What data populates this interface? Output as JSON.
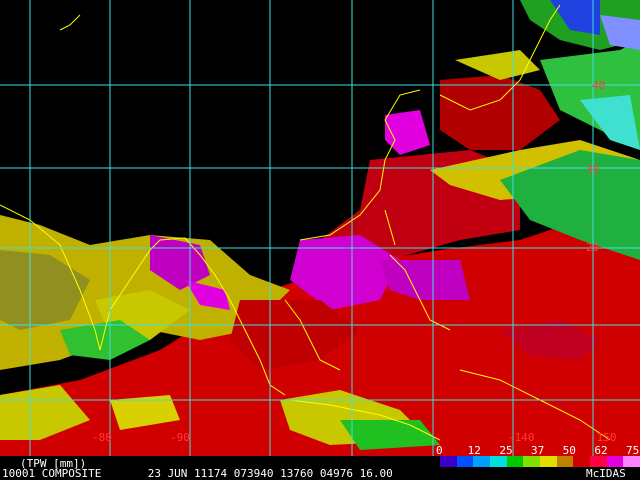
{
  "product": {
    "title": "(TPW [mm])",
    "info": "10001 COMPOSITE       23 JUN 11174 073940 13760 04976 16.00",
    "source": "McIDAS"
  },
  "grid": {
    "lon_labels": [
      "-80",
      "-90",
      "-140",
      "-150"
    ],
    "lat_labels": [
      "40",
      "30",
      "20"
    ]
  },
  "colorbar": {
    "ticks": [
      "0",
      "12",
      "25",
      "37",
      "50",
      "62",
      "75"
    ],
    "colors": [
      "#3a00c8",
      "#0050ff",
      "#00a0ff",
      "#00e0e0",
      "#00c800",
      "#80e000",
      "#e0e000",
      "#c08000",
      "#d00000",
      "#ff0040",
      "#e000e0",
      "#ff80ff"
    ]
  }
}
